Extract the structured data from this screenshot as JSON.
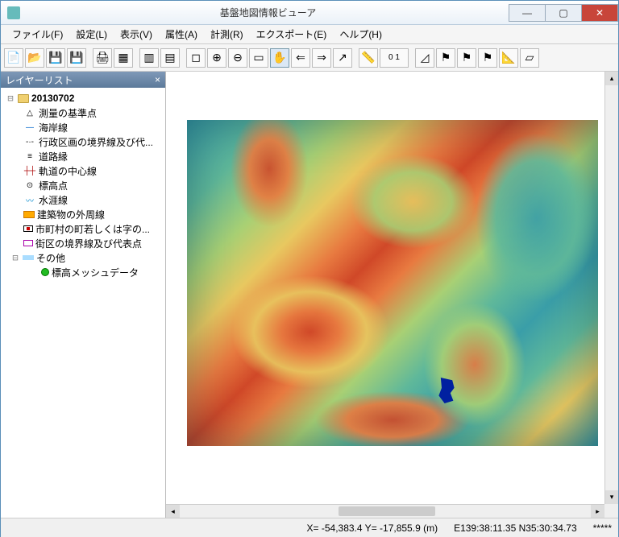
{
  "window": {
    "title": "基盤地図情報ビューア"
  },
  "menu": {
    "file": "ファイル(F)",
    "settings": "設定(L)",
    "view": "表示(V)",
    "attr": "属性(A)",
    "measure": "計測(R)",
    "export": "エクスポート(E)",
    "help": "ヘルプ(H)"
  },
  "toolbar": {
    "zoom_val": "0 1"
  },
  "sidebar": {
    "title": "レイヤーリスト",
    "root": "20130702",
    "layers": [
      "測量の基準点",
      "海岸線",
      "行政区画の境界線及び代...",
      "道路縁",
      "軌道の中心線",
      "標高点",
      "水涯線",
      "建築物の外周線",
      "市町村の町若しくは字の...",
      "街区の境界線及び代表点",
      "その他"
    ],
    "sublayer": "標高メッシュデータ"
  },
  "status": {
    "xy": "X= -54,383.4 Y= -17,855.9 (m)",
    "lonlat": "E139:38:11.35 N35:30:34.73",
    "extra": "*****"
  }
}
